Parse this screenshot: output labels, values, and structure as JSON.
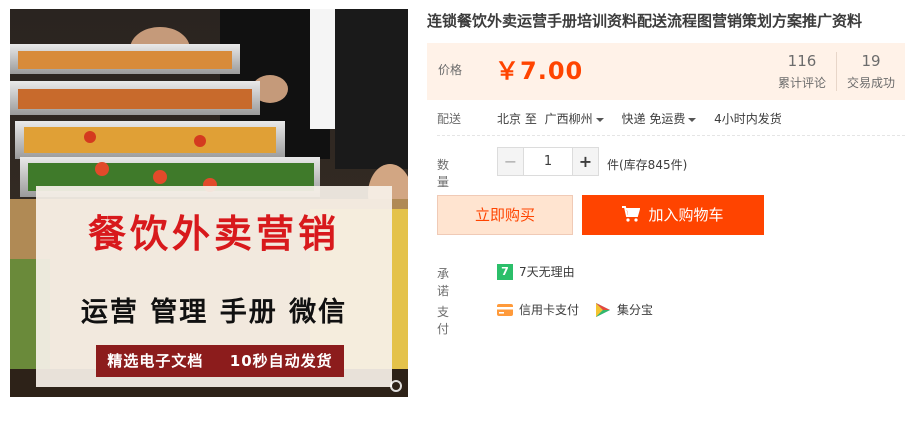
{
  "product": {
    "title": "连锁餐饮外卖运营手册培训资料配送流程图营销策划方案推广资料"
  },
  "image": {
    "headline": "餐饮外卖营销",
    "subline": "运营 管理 手册 微信",
    "band_left": "精选电子文档",
    "band_right": "10秒自动发货"
  },
  "price": {
    "label": "价格",
    "value": "￥7.00"
  },
  "stats": {
    "reviews_count": "116",
    "reviews_label": "累计评论",
    "sales_count": "19",
    "sales_label": "交易成功"
  },
  "shipping": {
    "label": "配送",
    "from": "北京 至",
    "to": "广西柳州",
    "method": "快递 免运费",
    "dispatch": "4小时内发货"
  },
  "quantity": {
    "label": "数量",
    "minus": "−",
    "value": "1",
    "plus": "+",
    "stock": "件(库存845件)"
  },
  "actions": {
    "buy_now": "立即购买",
    "add_to_cart": "加入购物车"
  },
  "promise": {
    "label": "承诺",
    "icon_text": "7",
    "text": "7天无理由"
  },
  "payment": {
    "label": "支付",
    "credit_card": "信用卡支付",
    "jifenbao": "集分宝"
  },
  "colors": {
    "accent": "#ff4400",
    "price_bg": "#fff2e8",
    "buy_now_bg": "#ffe4d0",
    "image_red": "#d8191c"
  }
}
